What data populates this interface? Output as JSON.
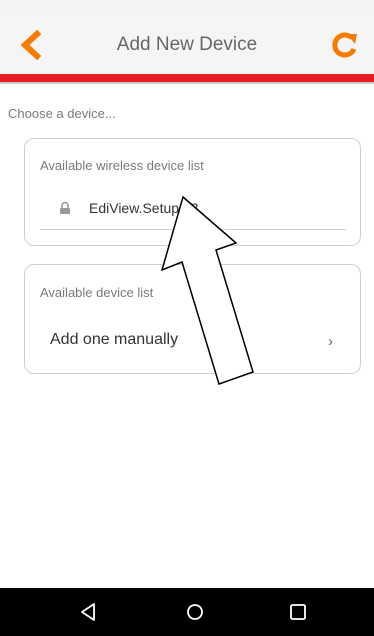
{
  "header": {
    "title": "Add New Device",
    "back_icon": "chevron-left-icon",
    "refresh_icon": "refresh-icon"
  },
  "colors": {
    "accent_orange": "#f57c00",
    "brand_red": "#e31e24"
  },
  "prompt": "Choose a device...",
  "wireless_list": {
    "title": "Available wireless device list",
    "items": [
      {
        "name": "EdiView.Setup 03",
        "icon": "lock-icon"
      }
    ]
  },
  "device_list": {
    "title": "Available device list",
    "add_manually": "Add one manually",
    "chevron": "›"
  },
  "nav": {
    "back_icon": "triangle-back-icon",
    "home_icon": "circle-home-icon",
    "recent_icon": "square-recent-icon"
  }
}
